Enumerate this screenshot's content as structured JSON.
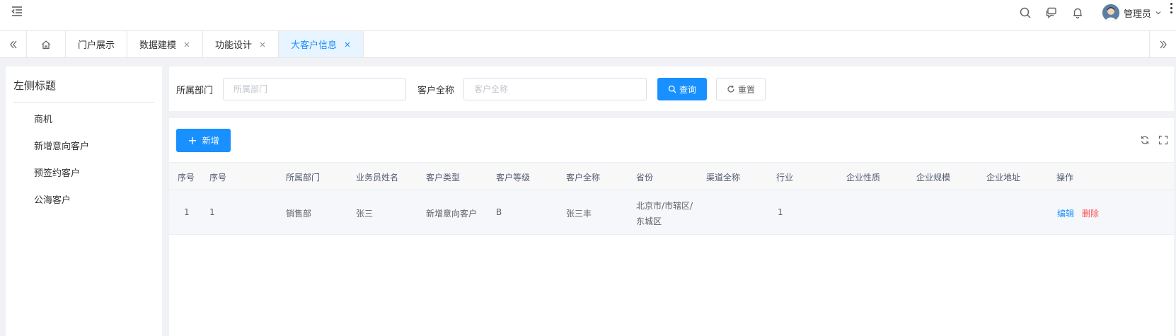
{
  "header": {
    "user_name": "管理员"
  },
  "tabs": [
    {
      "label": "门户展示",
      "closable": false
    },
    {
      "label": "数据建模",
      "closable": true
    },
    {
      "label": "功能设计",
      "closable": true
    },
    {
      "label": "大客户信息",
      "closable": true,
      "active": true
    }
  ],
  "sidebar": {
    "title": "左侧标题",
    "items": [
      "商机",
      "新增意向客户",
      "预签约客户",
      "公海客户"
    ]
  },
  "search": {
    "dept_label": "所属部门",
    "dept_placeholder": "所属部门",
    "customer_label": "客户全称",
    "customer_placeholder": "客户全称",
    "query_label": "查询",
    "reset_label": "重置"
  },
  "toolbar": {
    "add_label": "新增"
  },
  "table": {
    "columns": [
      "序号",
      "序号",
      "所属部门",
      "业务员姓名",
      "客户类型",
      "客户等级",
      "客户全称",
      "省份",
      "渠道全称",
      "行业",
      "企业性质",
      "企业规模",
      "企业地址",
      "操作"
    ],
    "rows": [
      {
        "index": "1",
        "seq": "1",
        "dept": "销售部",
        "salesman": "张三",
        "customer_type": "新增意向客户",
        "customer_level": "B",
        "customer_name": "张三丰",
        "province": "北京市/市辖区/东城区",
        "channel": "",
        "industry": "1",
        "enterprise_nature": "",
        "enterprise_scale": "",
        "enterprise_address": "",
        "edit_label": "编辑",
        "delete_label": "删除"
      }
    ]
  },
  "colors": {
    "primary": "#1890ff",
    "danger": "#ff4d4f",
    "active_tab_bg": "#e8f4ff"
  }
}
